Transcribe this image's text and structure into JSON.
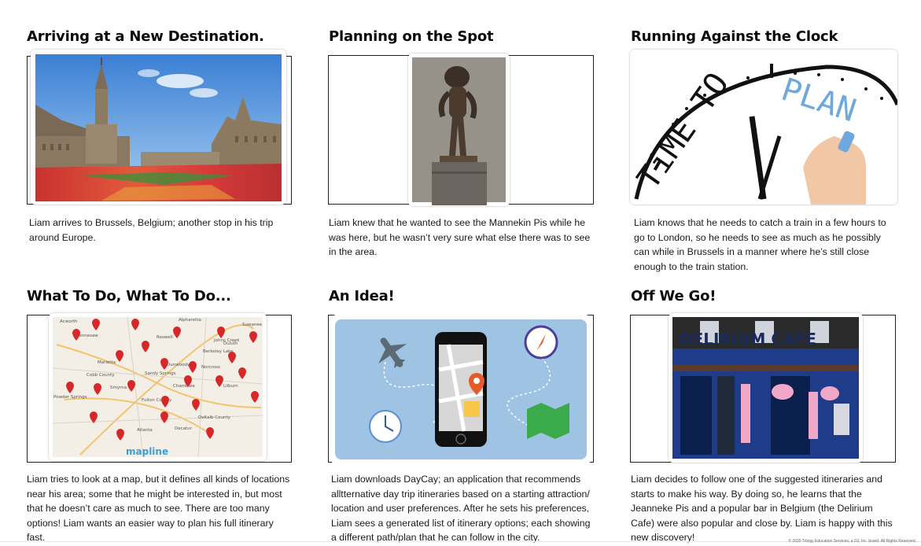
{
  "panels": [
    {
      "title": "Arriving at a New Destination.",
      "caption": "Liam arrives to Brussels, Belgium; another stop in his trip around Europe.",
      "image_icon": "grand-place-photo"
    },
    {
      "title": "Planning on the Spot",
      "caption": "Liam knew that he wanted to see the Mannekin Pis while he was here, but he wasn’t very sure what else there was to see in the area.",
      "image_icon": "statue-photo"
    },
    {
      "title": "Running Against the Clock",
      "caption": "Liam knows that he needs to catch a train in a few hours to go to London, so he needs to see as much as he possibly can while in Brussels in a manner where he’s still close enough to the train station.",
      "image_icon": "time-to-plan-clock-image",
      "image_text": {
        "time_to": "TiME TO",
        "plan": "PLAN"
      }
    },
    {
      "title": "What To Do, What To Do...",
      "caption": "Liam tries to look at a map, but it defines all kinds of locations near his area; some that he might be interested in, but most that he doesn’t care as much to see. There are too many options! Liam wants an easier way to plan his full itinerary fast.",
      "image_icon": "map-with-pins-image",
      "map_labels": [
        "Acworth",
        "Kennesaw",
        "Roswell",
        "Alpharetta",
        "Johns Creek",
        "Suwanee",
        "Duluth",
        "Berkeley Lake",
        "Marietta",
        "Dunwoody",
        "Norcross",
        "Sandy Springs",
        "Smyrna",
        "Chamblee",
        "Lilburn",
        "Fulton County",
        "Decatur",
        "Atlanta",
        "DeKalb County",
        "Powder Springs",
        "Cobb County"
      ],
      "map_brand": "mapline"
    },
    {
      "title": "An Idea!",
      "caption": "Liam downloads DayCay; an application that recommends alltternative day trip itineraries based on a starting attraction/ location and user preferences. After he sets his preferences, Liam sees a generated list of itinerary options; each showing a different path/plan that he can follow in the city.",
      "image_icon": "phone-travel-illustration"
    },
    {
      "title": "Off We Go!",
      "caption": "Liam decides to follow one of the suggested itineraries and starts to make his way. By doing so, he learns that the Jeanneke Pis and a popular bar in Belgium (the Delirium Cafe) were also popular and close by. Liam is happy with this new discovery!",
      "image_icon": "delirium-cafe-photo",
      "sign_text": "DELIRIUM CAFE"
    }
  ],
  "footer": "© 2020 Trilogy Education Services, a 2U, Inc. brand. All Rights Reserved.",
  "colors": {
    "sky": "#4f8fd8",
    "flower_red": "#d63a3a",
    "map_pin": "#d62828",
    "illus_bg": "#9fc3e2",
    "cafe_blue": "#1f3c8a",
    "plan_blue": "#6fa8dc"
  }
}
